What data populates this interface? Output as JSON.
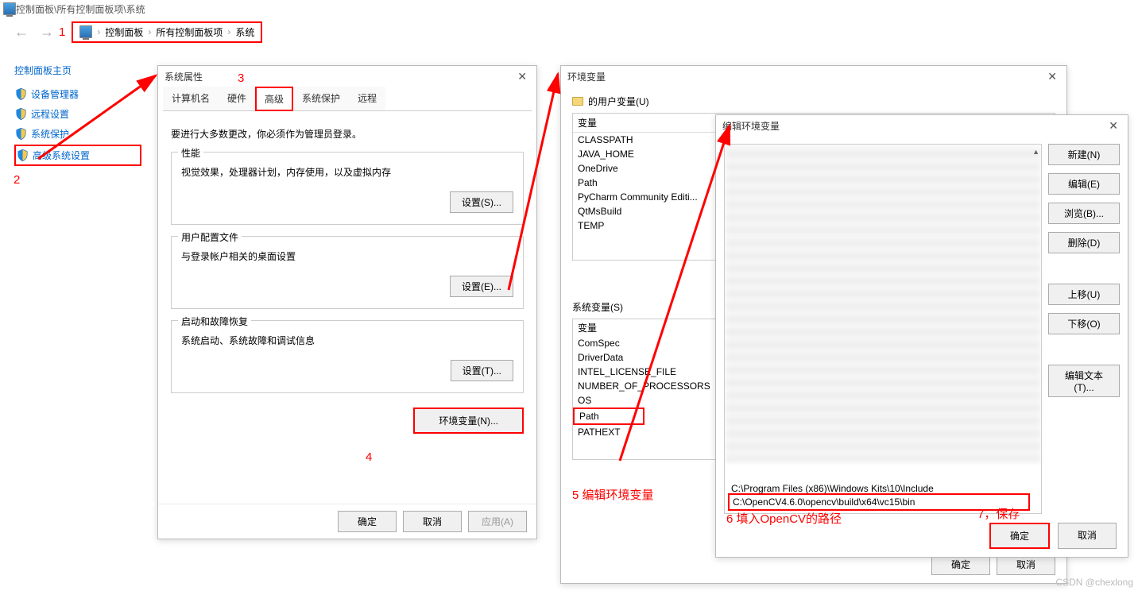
{
  "title": "控制面板\\所有控制面板项\\系统",
  "breadcrumb": {
    "b1": "控制面板",
    "b2": "所有控制面板项",
    "b3": "系统"
  },
  "sidebar": {
    "title": "控制面板主页",
    "items": [
      "设备管理器",
      "远程设置",
      "系统保护",
      "高级系统设置"
    ]
  },
  "sysprop": {
    "title": "系统属性",
    "tabs": [
      "计算机名",
      "硬件",
      "高级",
      "系统保护",
      "远程"
    ],
    "notice": "要进行大多数更改，你必须作为管理员登录。",
    "g1_title": "性能",
    "g1_text": "视觉效果，处理器计划，内存使用，以及虚拟内存",
    "g1_btn": "设置(S)...",
    "g2_title": "用户配置文件",
    "g2_text": "与登录帐户相关的桌面设置",
    "g2_btn": "设置(E)...",
    "g3_title": "启动和故障恢复",
    "g3_text": "系统启动、系统故障和调试信息",
    "g3_btn": "设置(T)...",
    "env_btn": "环境变量(N)...",
    "ok": "确定",
    "cancel": "取消",
    "apply": "应用(A)"
  },
  "env": {
    "title": "环境变量",
    "user_label": "的用户变量(U)",
    "sys_label": "系统变量(S)",
    "col_var": "变量",
    "user_vars": [
      "CLASSPATH",
      "JAVA_HOME",
      "OneDrive",
      "Path",
      "PyCharm Community Editi...",
      "QtMsBuild",
      "TEMP"
    ],
    "sys_vars": [
      "变量",
      "ComSpec",
      "DriverData",
      "INTEL_LICENSE_FILE",
      "NUMBER_OF_PROCESSORS",
      "OS",
      "Path",
      "PATHEXT"
    ],
    "ok": "确定",
    "cancel": "取消"
  },
  "edit": {
    "title": "编辑环境变量",
    "visible_paths": [
      "C:\\Program Files (x86)\\Windows Kits\\10\\Include",
      "C:\\OpenCV4.6.0\\opencv\\build\\x64\\vc15\\bin"
    ],
    "btns": {
      "new": "新建(N)",
      "edit": "编辑(E)",
      "browse": "浏览(B)...",
      "delete": "删除(D)",
      "up": "上移(U)",
      "down": "下移(O)",
      "edit_text": "编辑文本(T)..."
    },
    "ok": "确定",
    "cancel": "取消"
  },
  "annotations": {
    "n1": "1",
    "n2": "2",
    "n3": "3",
    "n4": "4",
    "n5": "5 编辑环境变量",
    "n6": "6 填入OpenCV的路径",
    "n7": "7，保存"
  },
  "watermark": "CSDN @chexlong"
}
